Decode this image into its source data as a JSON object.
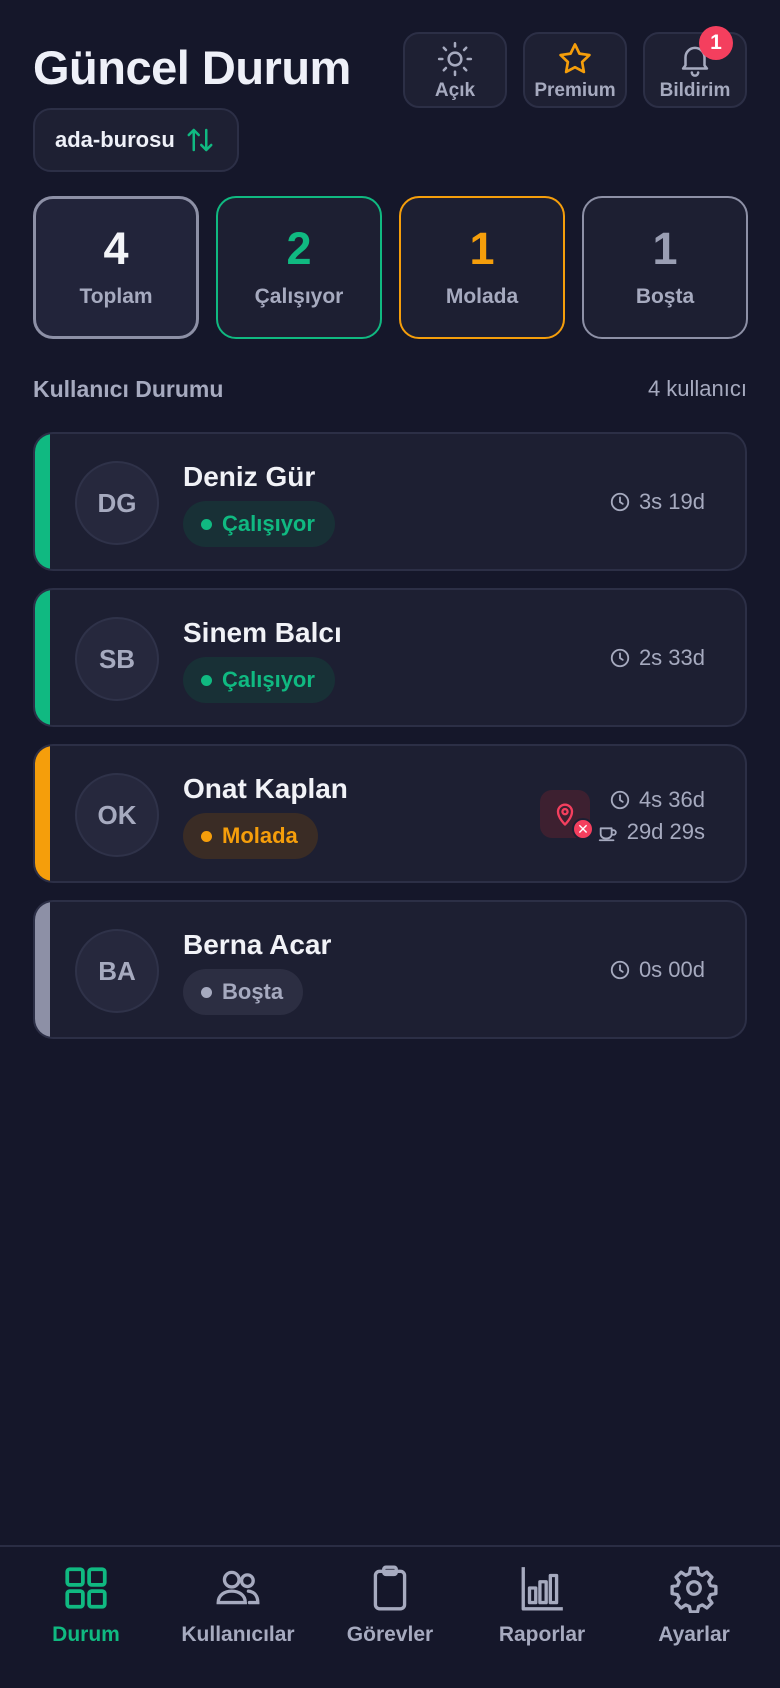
{
  "header": {
    "title": "Güncel Durum",
    "buttons": {
      "theme_label": "Açık",
      "premium_label": "Premium",
      "notifications_label": "Bildirim",
      "notifications_count": "1"
    }
  },
  "workspace": {
    "name": "ada-burosu",
    "icon": "swap-icon"
  },
  "stats": {
    "total": {
      "value": "4",
      "label": "Toplam"
    },
    "working": {
      "value": "2",
      "label": "Çalışıyor"
    },
    "break": {
      "value": "1",
      "label": "Molada"
    },
    "idle": {
      "value": "1",
      "label": "Boşta"
    }
  },
  "section": {
    "title": "Kullanıcı Durumu",
    "count": "4 kullanıcı"
  },
  "users": [
    {
      "initials": "DG",
      "name": "Deniz Gür",
      "status": "Çalışıyor",
      "time": "3s 19d"
    },
    {
      "initials": "SB",
      "name": "Sinem Balcı",
      "status": "Çalışıyor",
      "time": "2s 33d"
    },
    {
      "initials": "OK",
      "name": "Onat Kaplan",
      "status": "Molada",
      "time": "4s 36d",
      "break_time": "29d 29s"
    },
    {
      "initials": "BA",
      "name": "Berna Acar",
      "status": "Boşta",
      "time": "0s 00d"
    }
  ],
  "tabs": [
    {
      "label": "Durum",
      "icon": "grid-icon",
      "active": true
    },
    {
      "label": "Kullanıcılar",
      "icon": "users-icon"
    },
    {
      "label": "Görevler",
      "icon": "clipboard-icon"
    },
    {
      "label": "Raporlar",
      "icon": "bar-chart-icon"
    },
    {
      "label": "Ayarlar",
      "icon": "gear-icon"
    }
  ],
  "colors": {
    "background": "#15172a",
    "card": "#1d1f32",
    "working": "#10b981",
    "break": "#f59e0b",
    "idle": "#8d90a6",
    "alert": "#f43f5e"
  }
}
